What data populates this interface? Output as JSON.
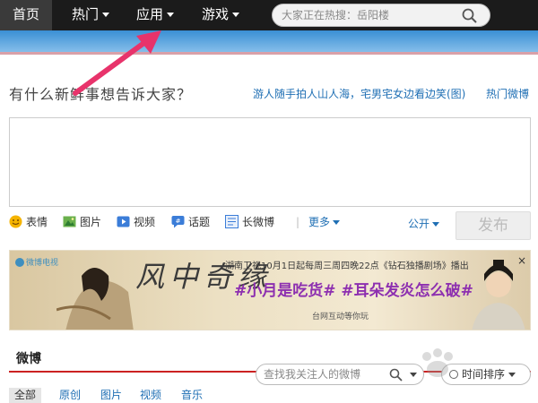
{
  "nav": {
    "home": "首页",
    "hot": "热门",
    "app": "应用",
    "game": "游戏",
    "search_placeholder": "大家正在热搜：岳阳楼"
  },
  "publish": {
    "question": "有什么新鲜事想告诉大家？",
    "topic_link": "游人随手拍人山人海，宅男宅女边看边笑(图)",
    "hot_link": "热门微博",
    "tools": [
      "表情",
      "图片",
      "视频",
      "话题",
      "长微博"
    ],
    "separator": "|",
    "more": "更多",
    "visibility": "公开",
    "submit": "发布"
  },
  "banner": {
    "logo": "微博电视",
    "title": "风中奇缘",
    "notice": "湖南卫视10月1日起每周三周四晚22点《钻石独播剧场》播出",
    "tags": "#小月是吃货# #耳朵发炎怎么破#",
    "footer": "台网互动等你玩",
    "close": "×"
  },
  "feed": {
    "title": "微博",
    "search_placeholder": "查找我关注人的微博",
    "sort": "时间排序",
    "tabs": [
      "全部",
      "原创",
      "图片",
      "视频",
      "音乐"
    ]
  },
  "colors": {
    "nav_bg": "#1b1b1b",
    "link": "#1f6fb4",
    "accent_red": "#cc2222",
    "arrow_pink": "#e8336b"
  }
}
